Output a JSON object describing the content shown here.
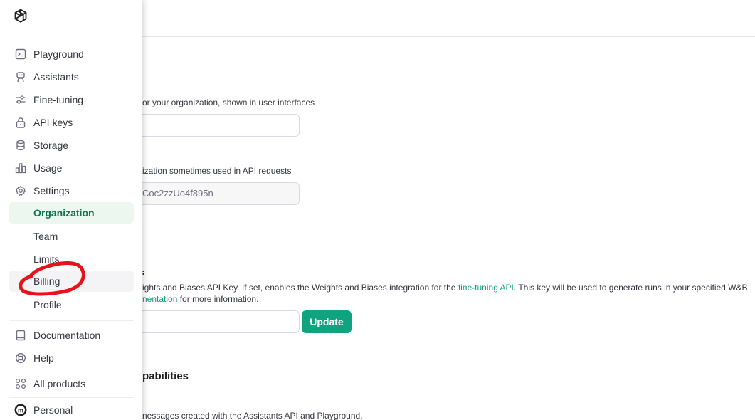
{
  "sidebar": {
    "logo": "openai-logo-icon",
    "items": [
      {
        "label": "Playground",
        "icon": "terminal-icon"
      },
      {
        "label": "Assistants",
        "icon": "robot-icon"
      },
      {
        "label": "Fine-tuning",
        "icon": "sliders-icon"
      },
      {
        "label": "API keys",
        "icon": "lock-icon"
      },
      {
        "label": "Storage",
        "icon": "database-icon"
      },
      {
        "label": "Usage",
        "icon": "bar-chart-icon"
      },
      {
        "label": "Settings",
        "icon": "gear-icon"
      }
    ],
    "settings_sub": [
      {
        "label": "Organization",
        "active": true
      },
      {
        "label": "Team"
      },
      {
        "label": "Limits"
      },
      {
        "label": "Billing"
      },
      {
        "label": "Profile"
      }
    ],
    "bottom": [
      {
        "label": "Documentation",
        "icon": "book-icon"
      },
      {
        "label": "Help",
        "icon": "lifebuoy-icon"
      },
      {
        "label": "All products",
        "icon": "grid-icon"
      }
    ],
    "account": {
      "label": "Personal",
      "avatar": "m"
    }
  },
  "main": {
    "org_name_desc": "or your organization, shown in user interfaces",
    "org_id_desc": "ization sometimes used in API requests",
    "org_id_value": "Coc2zzUo4f895n",
    "wandb_title": "s",
    "wandb_desc_1a": "ights and Biases API Key. If set, enables the Weights and Biases integration for the ",
    "wandb_desc_1_link": "fine-tuning API",
    "wandb_desc_1b": ". This key will be used to generate runs in your specified W&B",
    "wandb_desc_2_link": "nentation",
    "wandb_desc_2b": " for more information.",
    "update_label": "Update",
    "capabilities_title": "pabilities",
    "capabilities_desc": "nessages created with the Assistants API and Playground."
  },
  "colors": {
    "accent": "#10a37f",
    "annotation": "#e8121b"
  }
}
